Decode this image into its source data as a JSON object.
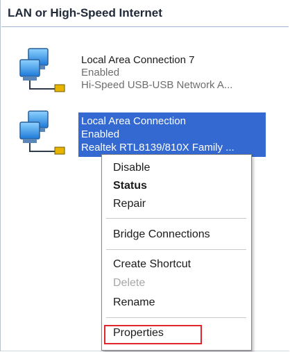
{
  "group": {
    "title": "LAN or High-Speed Internet"
  },
  "connections": [
    {
      "name": "Local Area Connection 7",
      "status": "Enabled",
      "device": "Hi-Speed USB-USB Network A..."
    },
    {
      "name": "Local Area Connection",
      "status": "Enabled",
      "device": "Realtek RTL8139/810X Family ...",
      "selected": true
    }
  ],
  "context_menu": {
    "items": [
      {
        "label": "Disable"
      },
      {
        "label": "Status",
        "bold": true
      },
      {
        "label": "Repair"
      },
      {
        "label": "Bridge Connections"
      },
      {
        "label": "Create Shortcut"
      },
      {
        "label": "Delete",
        "disabled": true
      },
      {
        "label": "Rename"
      },
      {
        "label": "Properties",
        "highlighted": true
      }
    ]
  },
  "colors": {
    "selection": "#3369d1",
    "highlight_box": "#e0262b",
    "header_rule": "#9fb6d3"
  },
  "icons": {
    "network_connection": "network-connection-icon"
  }
}
